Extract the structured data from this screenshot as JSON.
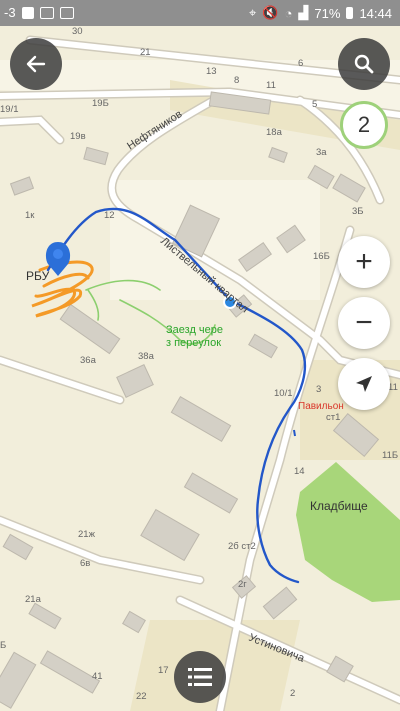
{
  "status_bar": {
    "left_text": "-3",
    "battery_percent": "71%",
    "time": "14:44"
  },
  "map": {
    "streets": [
      "Нефтяников",
      "Листвельный квартал",
      "Устиновича"
    ],
    "place_labels": {
      "rbu": "РБУ",
      "cemetery": "Кладбище",
      "pavilion": "Павильон"
    },
    "annotation": "Заезд чере з переулок",
    "house_numbers": [
      "30",
      "21",
      "13",
      "8",
      "6",
      "11",
      "5",
      "19/1",
      "19Б",
      "18а",
      "3а",
      "19в",
      "3Б",
      "1к",
      "12",
      "16Б",
      "36а",
      "38а",
      "10/1",
      "3",
      "ст1",
      "11",
      "11Б",
      "14",
      "21ж",
      "6в",
      "2б ст2",
      "2г",
      "21а",
      "Б",
      "17",
      "41",
      "22",
      "2"
    ]
  },
  "controls": {
    "back_icon": "arrow-left-icon",
    "search_icon": "search-icon",
    "notification_count": "2",
    "zoom_in": "+",
    "zoom_out": "−",
    "locate_icon": "navigation-arrow-icon",
    "menu_icon": "list-menu-icon"
  },
  "colors": {
    "route": "#2357c9",
    "cemetery": "#a8d67a",
    "scribble": "#f5961e",
    "annotation": "#2aa52a",
    "pavilion": "#d9372a",
    "badge_ring": "#9ed17a"
  }
}
